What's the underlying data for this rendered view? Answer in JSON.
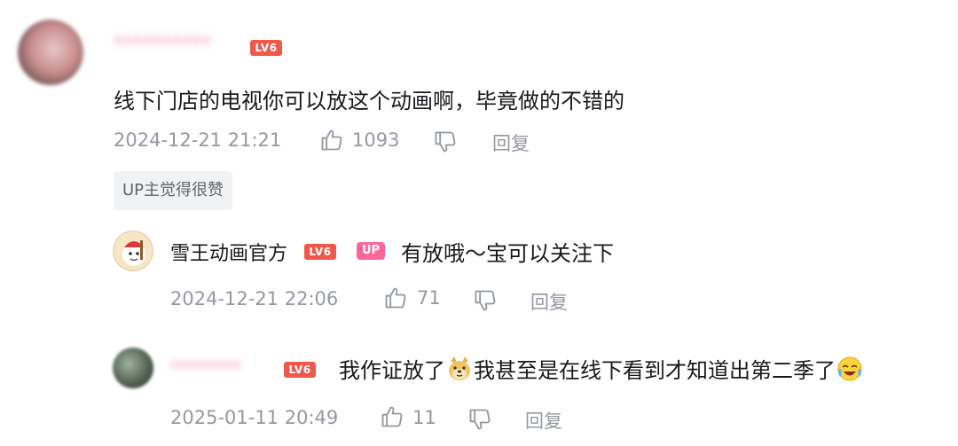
{
  "comment": {
    "username": "**********",
    "level": "LV6",
    "text": "线下门店的电视你可以放这个动画啊，毕竟做的不错的",
    "timestamp": "2024-12-21 21:21",
    "likes": "1093",
    "reply_label": "回复",
    "badge": "UP主觉得很赞"
  },
  "replies": [
    {
      "username": "雪王动画官方",
      "level": "LV6",
      "up_tag": "UP",
      "text": "有放哦～宝可以关注下",
      "timestamp": "2024-12-21 22:06",
      "likes": "71",
      "reply_label": "回复"
    },
    {
      "username": "********",
      "level": "LV6",
      "text_part1": "我作证放了",
      "text_part2": "我甚至是在线下看到才知道出第二季了",
      "emoji1": "doge-emoji",
      "emoji2": "laughing-crying-emoji",
      "timestamp": "2025-01-11 20:49",
      "likes": "11",
      "reply_label": "回复"
    }
  ]
}
